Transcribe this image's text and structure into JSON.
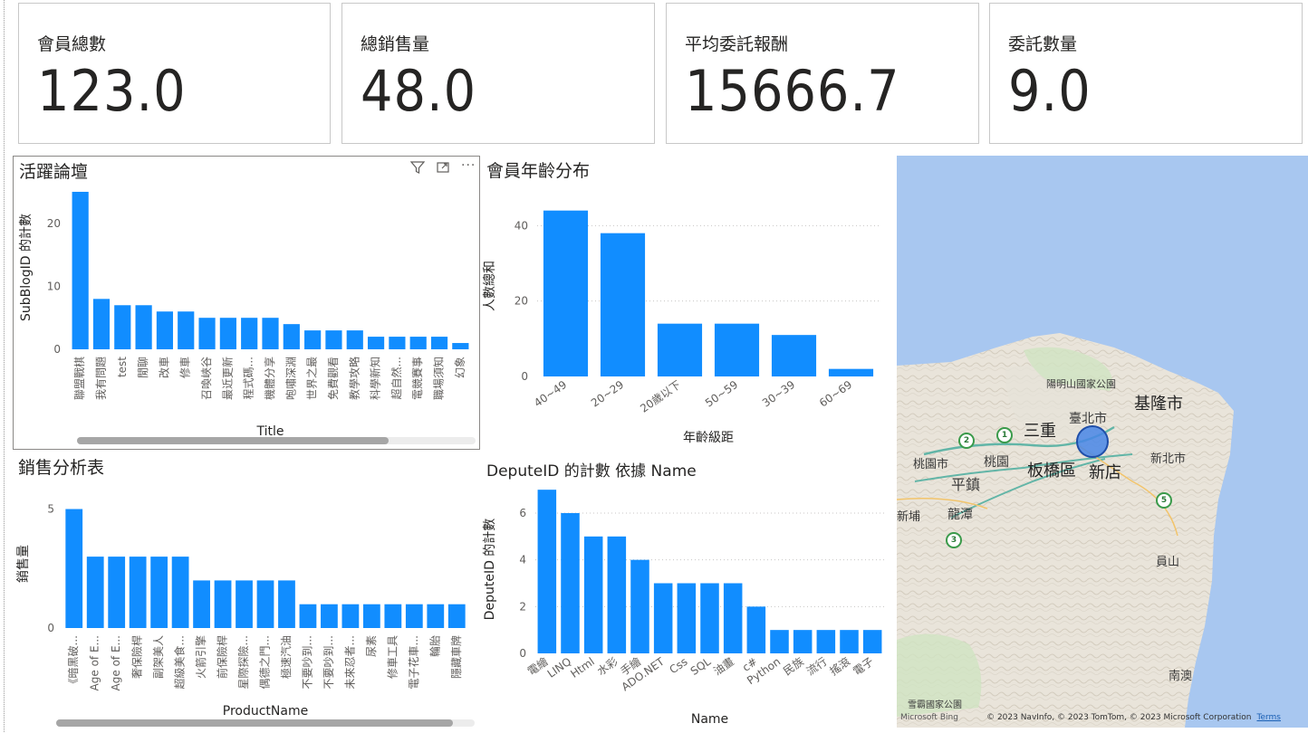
{
  "kpis": [
    {
      "label": "會員總數",
      "value": "123.0"
    },
    {
      "label": "總銷售量",
      "value": "48.0"
    },
    {
      "label": "平均委託報酬",
      "value": "15666.7"
    },
    {
      "label": "委託數量",
      "value": "9.0"
    }
  ],
  "charts": {
    "forum": {
      "title": "活躍論壇",
      "xlabel": "Title",
      "ylabel": "SubBlogID 的計數"
    },
    "age": {
      "title": "會員年齡分布",
      "xlabel": "年齡級距",
      "ylabel": "人數總和"
    },
    "sales": {
      "title": "銷售分析表",
      "xlabel": "ProductName",
      "ylabel": "銷售量"
    },
    "depute": {
      "title": "DeputeID 的計數 依據 Name",
      "xlabel": "Name",
      "ylabel": "DeputeID 的計數"
    }
  },
  "icons": {
    "filter": "filter-icon",
    "focus": "focus-mode-icon",
    "more": "more-options-icon"
  },
  "colors": {
    "bar": "#118dff",
    "map_water": "#a8c7f0",
    "bubble": "#4886e6"
  },
  "chart_data": [
    {
      "type": "bar",
      "title": "活躍論壇",
      "xlabel": "Title",
      "ylabel": "SubBlogID 的計數",
      "categories": [
        "聯盟戰棋",
        "我有問題",
        "test",
        "閒聊",
        "改車",
        "修車",
        "召喚峽谷",
        "最近更新",
        "程式碼...",
        "機體分享",
        "咆嘯深淵",
        "世界之最",
        "免費觀看",
        "教學攻略",
        "科學新知",
        "超自然...",
        "電競賽事",
        "職場須知",
        "幻象"
      ],
      "values": [
        25,
        8,
        7,
        7,
        6,
        6,
        5,
        5,
        5,
        5,
        4,
        3,
        3,
        3,
        2,
        2,
        2,
        2,
        1
      ],
      "yticks": [
        0,
        10,
        20
      ],
      "ylim": [
        0,
        26
      ]
    },
    {
      "type": "bar",
      "title": "會員年齡分布",
      "xlabel": "年齡級距",
      "ylabel": "人數總和",
      "categories": [
        "40~49",
        "20~29",
        "20歲以下",
        "50~59",
        "30~39",
        "60~69"
      ],
      "values": [
        44,
        38,
        14,
        14,
        11,
        2
      ],
      "yticks": [
        0,
        20,
        40
      ],
      "ylim": [
        0,
        48
      ]
    },
    {
      "type": "bar",
      "title": "銷售分析表",
      "xlabel": "ProductName",
      "ylabel": "銷售量",
      "categories": [
        "《暗黑破...",
        "Age of E...",
        "Age of E...",
        "奢保險桿",
        "副架美人",
        "超級美食...",
        "火箭引擎",
        "前保險桿",
        "星際探險...",
        "偶德之門...",
        "極速汽油",
        "不要吵到...",
        "不要吵到...",
        "未來忍者...",
        "尿素",
        "修車工具",
        "電子花車...",
        "輪胎",
        "隱藏車牌"
      ],
      "values": [
        5,
        3,
        3,
        3,
        3,
        3,
        2,
        2,
        2,
        2,
        2,
        1,
        1,
        1,
        1,
        1,
        1,
        1,
        1
      ],
      "yticks": [
        0,
        5
      ],
      "ylim": [
        0,
        5.4
      ]
    },
    {
      "type": "bar",
      "title": "DeputeID 的計數 依據 Name",
      "xlabel": "Name",
      "ylabel": "DeputeID 的計數",
      "categories": [
        "電繪",
        "LINQ",
        "Html",
        "水彩",
        "手繪",
        "ADO.NET",
        "Css",
        "SQL",
        "油畫",
        "c#",
        "Python",
        "民族",
        "流行",
        "搖滾",
        "電子"
      ],
      "values": [
        7,
        6,
        5,
        5,
        4,
        3,
        3,
        3,
        3,
        2,
        1,
        1,
        1,
        1,
        1
      ],
      "yticks": [
        0,
        2,
        4,
        6
      ],
      "ylim": [
        0,
        7.2
      ]
    }
  ],
  "map": {
    "labels": [
      "陽明山國家公園",
      "臺北市",
      "基隆市",
      "三重",
      "桃園市",
      "桃園",
      "平鎮",
      "板橋區",
      "新店",
      "新北市",
      "新埔",
      "龍潭",
      "員山",
      "南澳",
      "雪霸國家公園"
    ],
    "pins": [
      "2",
      "1",
      "5",
      "3"
    ],
    "bing": "Microsoft Bing",
    "attribution": "© 2023 NavInfo, © 2023 TomTom, © 2023 Microsoft Corporation",
    "terms": "Terms"
  }
}
